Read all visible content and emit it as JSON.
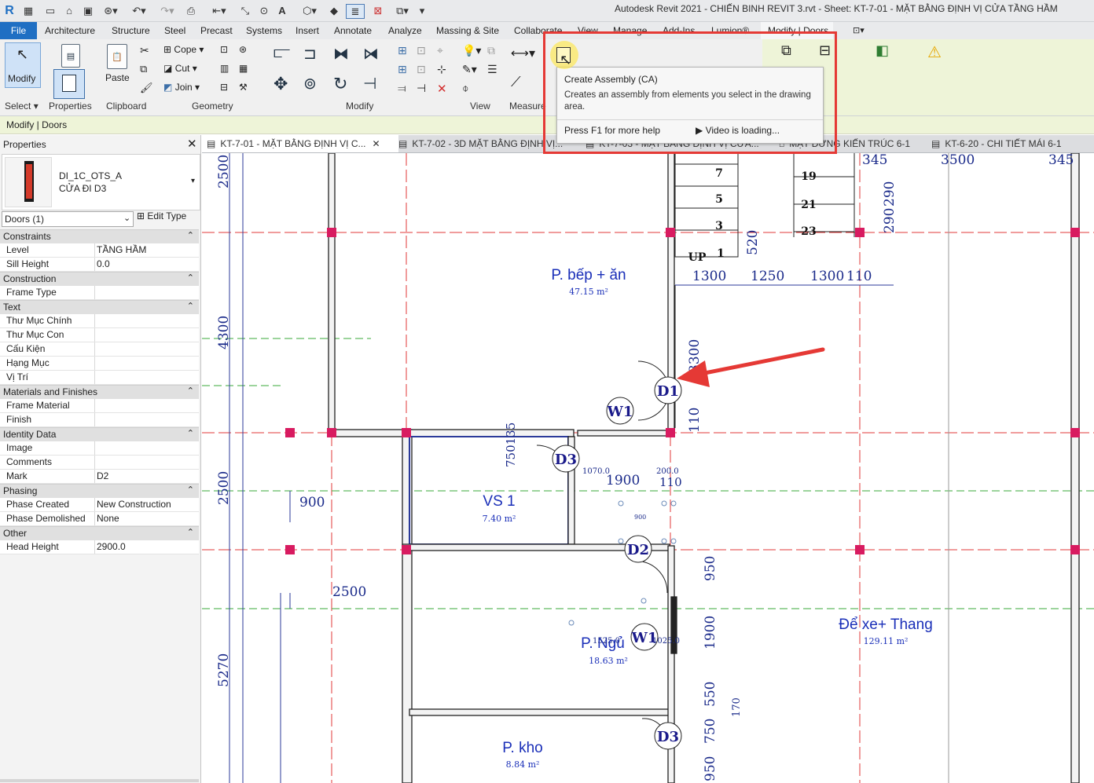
{
  "app": {
    "title": "Autodesk Revit 2021 - CHIẾN BINH REVIT 3.rvt - Sheet: KT-7-01 - MẶT BẰNG ĐỊNH VỊ CỬA TẦNG HẦM",
    "logo": "R"
  },
  "menu": {
    "file": "File",
    "tabs": [
      "Architecture",
      "Structure",
      "Steel",
      "Precast",
      "Systems",
      "Insert",
      "Annotate",
      "Analyze",
      "Massing & Site",
      "Collaborate",
      "View",
      "Manage",
      "Add-Ins",
      "Lumion®",
      "Modify | Doors"
    ]
  },
  "ribbon": {
    "modify": "Modify",
    "paste": "Paste",
    "cope": "Cope",
    "cut": "Cut",
    "join": "Join",
    "panels": {
      "select": "Select",
      "properties": "Properties",
      "clipboard": "Clipboard",
      "geometry": "Geometry",
      "modify": "Modify",
      "view": "View",
      "measure": "Measure"
    }
  },
  "context_bar": "Modify | Doors",
  "tooltip": {
    "title": "Create Assembly (CA)",
    "description": "Creates an assembly from elements you select in the drawing area.",
    "help": "Press F1 for more help",
    "video": "Video is loading..."
  },
  "properties": {
    "title": "Properties",
    "family": "DI_1C_OTS_A",
    "type": "CỬA ĐI D3",
    "filter": "Doors (1)",
    "edit_type": "Edit Type",
    "groups": [
      {
        "name": "Constraints",
        "rows": [
          {
            "k": "Level",
            "v": "TẦNG HẦM"
          },
          {
            "k": "Sill Height",
            "v": "0.0"
          }
        ]
      },
      {
        "name": "Construction",
        "rows": [
          {
            "k": "Frame Type",
            "v": ""
          }
        ]
      },
      {
        "name": "Text",
        "rows": [
          {
            "k": "Thư Mục Chính",
            "v": ""
          },
          {
            "k": "Thư Mục Con",
            "v": ""
          },
          {
            "k": "Cấu Kiện",
            "v": ""
          },
          {
            "k": "Hạng Mục",
            "v": ""
          },
          {
            "k": "Vị Trí",
            "v": ""
          }
        ]
      },
      {
        "name": "Materials and Finishes",
        "rows": [
          {
            "k": "Frame Material",
            "v": ""
          },
          {
            "k": "Finish",
            "v": ""
          }
        ]
      },
      {
        "name": "Identity Data",
        "rows": [
          {
            "k": "Image",
            "v": ""
          },
          {
            "k": "Comments",
            "v": ""
          },
          {
            "k": "Mark",
            "v": "D2"
          }
        ]
      },
      {
        "name": "Phasing",
        "rows": [
          {
            "k": "Phase Created",
            "v": "New Construction"
          },
          {
            "k": "Phase Demolished",
            "v": "None"
          }
        ]
      },
      {
        "name": "Other",
        "rows": [
          {
            "k": "Head Height",
            "v": "2900.0"
          }
        ]
      }
    ]
  },
  "view_tabs": [
    "KT-7-01 - MẶT BẰNG ĐỊNH VỊ C...",
    "KT-7-02 - 3D MẶT BẰNG ĐỊNH VỊ...",
    "KT-7-03 - MẶT BẰNG ĐỊNH VỊ CỬA...",
    "MẶT ĐỨNG KIẾN TRÚC 6-1",
    "KT-6-20 - CHI TIẾT MÁI 6-1"
  ],
  "drawing": {
    "rooms": [
      {
        "name": "P. bếp + ăn",
        "area": "47.15 m²"
      },
      {
        "name": "VS 1",
        "area": "7.40 m²"
      },
      {
        "name": "P. Ngủ",
        "area": "18.63 m²"
      },
      {
        "name": "Để xe+ Thang",
        "area": "129.11 m²"
      },
      {
        "name": "P. kho",
        "area": "8.84 m²"
      }
    ],
    "tags": [
      "D1",
      "W1",
      "D3",
      "D2",
      "W1",
      "D3"
    ],
    "stair_numbers": [
      "7",
      "5",
      "3",
      "1",
      "19",
      "21",
      "23"
    ],
    "stair_up": "UP",
    "dims": {
      "left": [
        "2500",
        "4300",
        "2500",
        "5270"
      ],
      "top": [
        "345",
        "3500",
        "345"
      ],
      "stair": [
        "290",
        "290",
        "520",
        "1300",
        "1250",
        "1300",
        "110"
      ],
      "mid": [
        "3300",
        "110",
        "750135",
        "1070.0",
        "1900",
        "200.0",
        "110",
        "900",
        "900",
        "2500"
      ],
      "right": [
        "950",
        "1900",
        "550",
        "170",
        "750",
        "950"
      ],
      "small": [
        "1525.0",
        "1025.0"
      ]
    }
  },
  "colors": {
    "accent": "#1f6fc3",
    "context": "#eef4d8",
    "highlight": "#e53935",
    "room_text": "#1a2fb8",
    "grid": "#e03a3a",
    "grid_green": "#3aa83a"
  }
}
